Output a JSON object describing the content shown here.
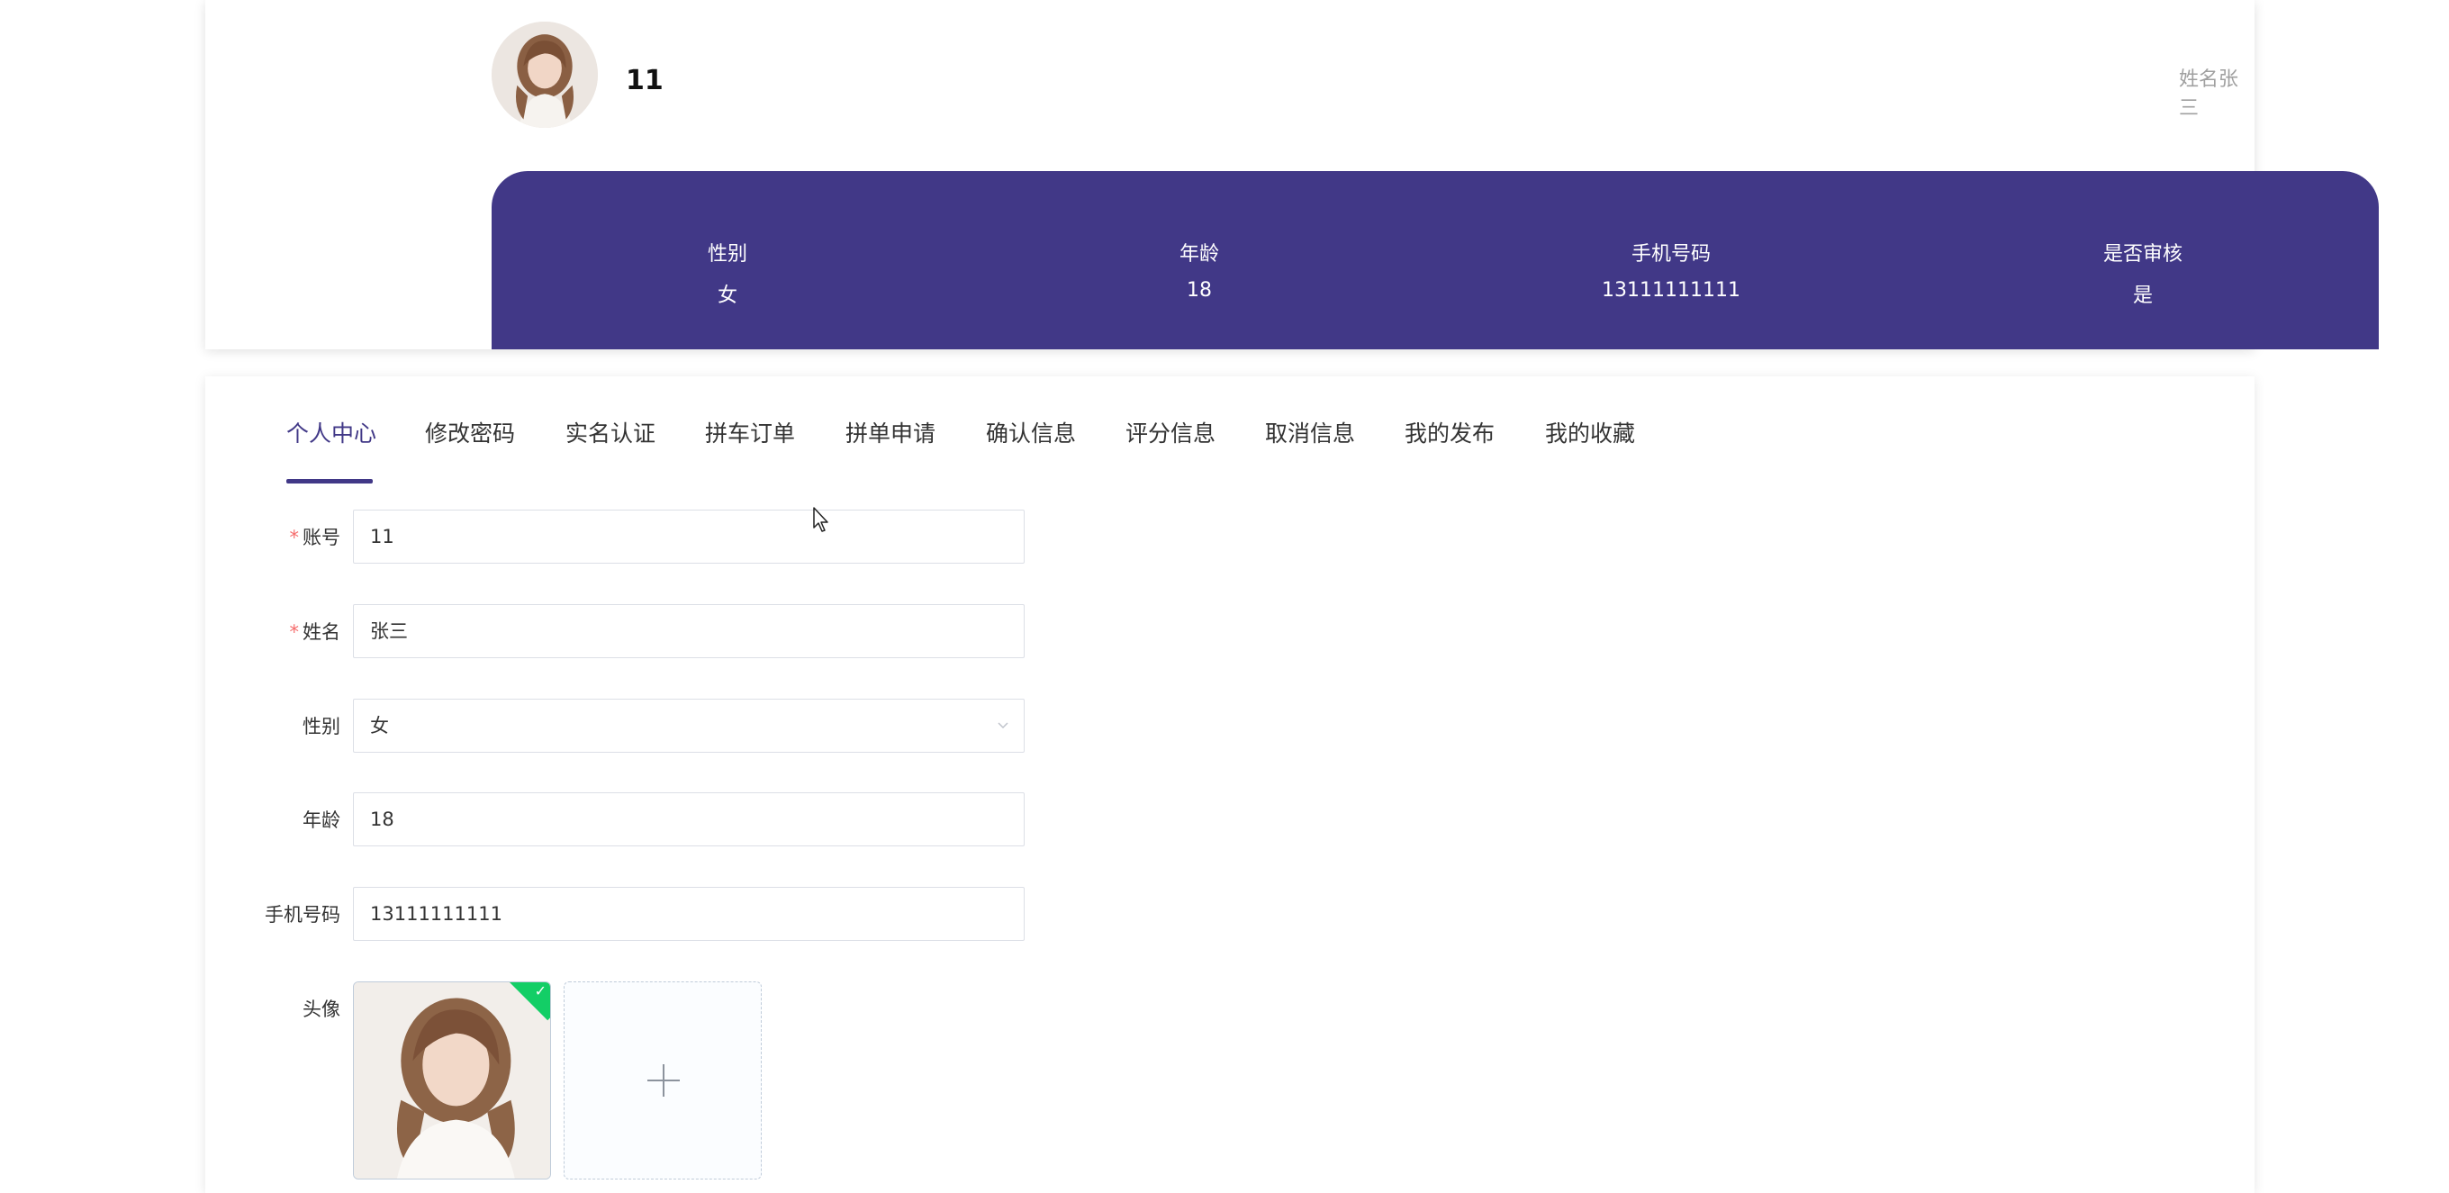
{
  "profile": {
    "username": "11",
    "name_note": "姓名张三"
  },
  "stats": [
    {
      "label": "性别",
      "value": "女"
    },
    {
      "label": "年龄",
      "value": "18"
    },
    {
      "label": "手机号码",
      "value": "13111111111"
    },
    {
      "label": "是否审核",
      "value": "是"
    }
  ],
  "tabs": [
    {
      "label": "个人中心",
      "active": true
    },
    {
      "label": "修改密码"
    },
    {
      "label": "实名认证"
    },
    {
      "label": "拼车订单"
    },
    {
      "label": "拼单申请"
    },
    {
      "label": "确认信息"
    },
    {
      "label": "评分信息"
    },
    {
      "label": "取消信息"
    },
    {
      "label": "我的发布"
    },
    {
      "label": "我的收藏"
    }
  ],
  "form": {
    "account": {
      "label": "账号",
      "required": "*",
      "value": "11"
    },
    "name": {
      "label": "姓名",
      "required": "*",
      "value": "张三"
    },
    "gender": {
      "label": "性别",
      "value": "女"
    },
    "age": {
      "label": "年龄",
      "value": "18"
    },
    "phone": {
      "label": "手机号码",
      "value": "13111111111"
    },
    "avatar": {
      "label": "头像"
    }
  },
  "colors": {
    "accent": "#413887",
    "success": "#13ce66",
    "required": "#f56c6c"
  },
  "icons": {
    "select_arrow": "chevron-down-icon",
    "upload_plus": "plus-icon",
    "upload_success": "check-icon",
    "cursor": "mouse-pointer-icon"
  }
}
